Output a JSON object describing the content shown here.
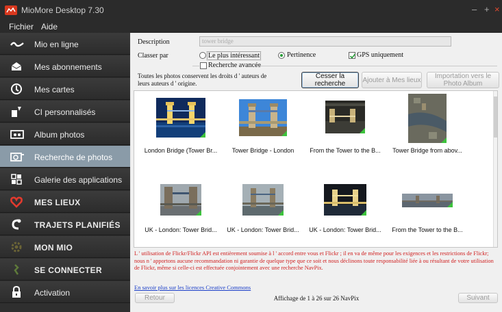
{
  "window": {
    "title": "MioMore Desktop 7.30",
    "controls": [
      "–",
      "+",
      "×"
    ]
  },
  "menu": [
    {
      "label": "Fichier"
    },
    {
      "label": "Aide"
    }
  ],
  "sidebar": {
    "items": [
      {
        "label": "Mio en ligne",
        "icon": "mio-online-icon"
      },
      {
        "label": "Mes abonnements",
        "icon": "envelope-icon"
      },
      {
        "label": "Mes cartes",
        "icon": "map-icon"
      },
      {
        "label": "CI personnalisés",
        "icon": "poi-icon"
      },
      {
        "label": "Album photos",
        "icon": "album-icon"
      },
      {
        "label": "Recherche de photos",
        "icon": "camera-icon",
        "active": true
      },
      {
        "label": "Galerie des applications",
        "icon": "apps-icon"
      },
      {
        "label": "MES LIEUX",
        "icon": "heart-icon"
      },
      {
        "label": "TRAJETS PLANIFIÉS",
        "icon": "route-icon"
      },
      {
        "label": "MON MIO",
        "icon": "gear-icon"
      },
      {
        "label": "SE CONNECTER",
        "icon": "connect-icon"
      },
      {
        "label": "Activation",
        "icon": "lock-icon"
      }
    ]
  },
  "search": {
    "description_label": "Description",
    "description_value": "tower bridge",
    "sort_label": "Classer par",
    "sort_options": [
      {
        "label": "Le plus intéressant",
        "selected": false
      },
      {
        "label": "Pertinence",
        "selected": true
      }
    ],
    "gps_only_label": "GPS uniquement",
    "gps_only_checked": true,
    "advanced_label": "Recherche avancée",
    "advanced_checked": false,
    "rights_note": "Toutes les photos conservent les droits d ' auteurs de leurs auteurs d ' origine.",
    "cancel_button": "Cesser la recherche",
    "add_button": "Ajouter à Mes lieux",
    "import_button": "Importation vers le Photo Album"
  },
  "results": [
    {
      "caption": "London Bridge (Tower Br...",
      "gps": true
    },
    {
      "caption": "Tower Bridge - London",
      "gps": true
    },
    {
      "caption": "From the Tower to the B...",
      "gps": true
    },
    {
      "caption": "Tower Bridge from abov...",
      "gps": true
    },
    {
      "caption": "UK - London: Tower Brid...",
      "gps": true
    },
    {
      "caption": "UK - London: Tower Brid...",
      "gps": true
    },
    {
      "caption": "UK - London: Tower Brid...",
      "gps": true
    },
    {
      "caption": "From the Tower to the B...",
      "gps": true
    }
  ],
  "legal_text": "L ' utilisation de Flickr/Flickr API est entièrement soumise à l ' accord entre vous et Flickr ; il en va de même pour les exigences et les restrictions de Flickr; nous n ' apportons aucune recommandation ni garantie de quelque type que ce soit et nous déclinons toute responsabilité liée à ou résultant de votre utilisation de Flickr, même si celle-ci est effectuée conjointement avec une recherche NavPix.",
  "cc_link": "En savoir plus sur les licences Creative Commons",
  "pagination": {
    "back": "Retour",
    "count": "Affichage de 1 à 26 sur 26 NavPix",
    "next": "Suivant"
  },
  "colors": {
    "gps_badge": "#3cc33c",
    "legal": "#d02020",
    "active_item": "#8a9ba8"
  }
}
